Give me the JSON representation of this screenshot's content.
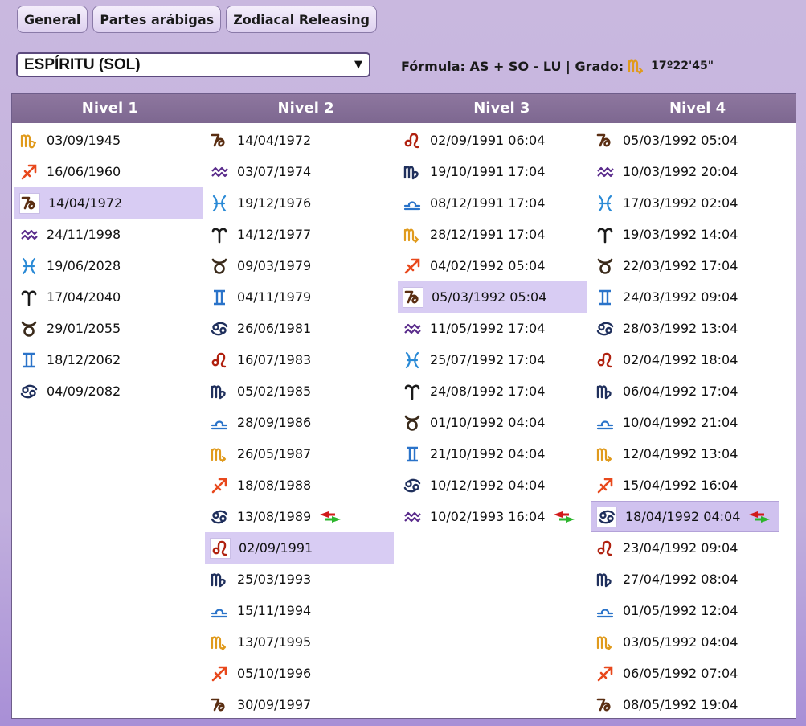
{
  "tabs": [
    "General",
    "Partes arábigas",
    "Zodiacal Releasing"
  ],
  "lot_select": "ESPÍRITU (SOL)",
  "formula": {
    "label": "Fórmula: AS + SO - LU | Grado:",
    "sign": "scorpio",
    "degree": "17º22'45\""
  },
  "columns": [
    {
      "header": "Nivel 1",
      "rows": [
        {
          "sign": "virgo",
          "date": "03/09/1945"
        },
        {
          "sign": "sagittarius",
          "date": "16/06/1960"
        },
        {
          "sign": "capricorn",
          "date": "14/04/1972",
          "selected": true
        },
        {
          "sign": "aquarius",
          "date": "24/11/1998"
        },
        {
          "sign": "pisces",
          "date": "19/06/2028"
        },
        {
          "sign": "aries",
          "date": "17/04/2040"
        },
        {
          "sign": "taurus",
          "date": "29/01/2055"
        },
        {
          "sign": "gemini",
          "date": "18/12/2062"
        },
        {
          "sign": "cancer",
          "date": "04/09/2082"
        }
      ]
    },
    {
      "header": "Nivel 2",
      "rows": [
        {
          "sign": "capricorn",
          "date": "14/04/1972"
        },
        {
          "sign": "aquarius",
          "date": "03/07/1974"
        },
        {
          "sign": "pisces",
          "date": "19/12/1976"
        },
        {
          "sign": "aries",
          "date": "14/12/1977"
        },
        {
          "sign": "taurus",
          "date": "09/03/1979"
        },
        {
          "sign": "gemini",
          "date": "04/11/1979"
        },
        {
          "sign": "cancer",
          "date": "26/06/1981"
        },
        {
          "sign": "leo",
          "date": "16/07/1983"
        },
        {
          "sign": "virgo2",
          "date": "05/02/1985"
        },
        {
          "sign": "libra",
          "date": "28/09/1986"
        },
        {
          "sign": "scorpio",
          "date": "26/05/1987"
        },
        {
          "sign": "sagittarius",
          "date": "18/08/1988"
        },
        {
          "sign": "cancer",
          "date": "13/08/1989",
          "swap": true
        },
        {
          "sign": "leo",
          "date": "02/09/1991",
          "selected": true
        },
        {
          "sign": "virgo2",
          "date": "25/03/1993"
        },
        {
          "sign": "libra",
          "date": "15/11/1994"
        },
        {
          "sign": "scorpio",
          "date": "13/07/1995"
        },
        {
          "sign": "sagittarius",
          "date": "05/10/1996"
        },
        {
          "sign": "capricorn",
          "date": "30/09/1997"
        }
      ]
    },
    {
      "header": "Nivel 3",
      "rows": [
        {
          "sign": "leo",
          "date": "02/09/1991 06:04"
        },
        {
          "sign": "virgo2",
          "date": "19/10/1991 17:04"
        },
        {
          "sign": "libra",
          "date": "08/12/1991 17:04"
        },
        {
          "sign": "scorpio",
          "date": "28/12/1991 17:04"
        },
        {
          "sign": "sagittarius",
          "date": "04/02/1992 05:04"
        },
        {
          "sign": "capricorn",
          "date": "05/03/1992 05:04",
          "selected": true
        },
        {
          "sign": "aquarius",
          "date": "11/05/1992 17:04"
        },
        {
          "sign": "pisces",
          "date": "25/07/1992 17:04"
        },
        {
          "sign": "aries",
          "date": "24/08/1992 17:04"
        },
        {
          "sign": "taurus",
          "date": "01/10/1992 04:04"
        },
        {
          "sign": "gemini",
          "date": "21/10/1992 04:04"
        },
        {
          "sign": "cancer",
          "date": "10/12/1992 04:04"
        },
        {
          "sign": "aquarius",
          "date": "10/02/1993 16:04",
          "swap": true
        }
      ]
    },
    {
      "header": "Nivel 4",
      "rows": [
        {
          "sign": "capricorn",
          "date": "05/03/1992 05:04"
        },
        {
          "sign": "aquarius",
          "date": "10/03/1992 20:04"
        },
        {
          "sign": "pisces",
          "date": "17/03/1992 02:04"
        },
        {
          "sign": "aries",
          "date": "19/03/1992 14:04"
        },
        {
          "sign": "taurus",
          "date": "22/03/1992 17:04"
        },
        {
          "sign": "gemini",
          "date": "24/03/1992 09:04"
        },
        {
          "sign": "cancer",
          "date": "28/03/1992 13:04"
        },
        {
          "sign": "leo",
          "date": "02/04/1992 18:04"
        },
        {
          "sign": "virgo2",
          "date": "06/04/1992 17:04"
        },
        {
          "sign": "libra",
          "date": "10/04/1992 21:04"
        },
        {
          "sign": "scorpio",
          "date": "12/04/1992 13:04"
        },
        {
          "sign": "sagittarius",
          "date": "15/04/1992 16:04"
        },
        {
          "sign": "cancer",
          "date": "18/04/1992 04:04",
          "selected": true,
          "strong": true,
          "swap": true
        },
        {
          "sign": "leo",
          "date": "23/04/1992 09:04"
        },
        {
          "sign": "virgo2",
          "date": "27/04/1992 08:04"
        },
        {
          "sign": "libra",
          "date": "01/05/1992 12:04"
        },
        {
          "sign": "scorpio",
          "date": "03/05/1992 04:04"
        },
        {
          "sign": "sagittarius",
          "date": "06/05/1992 07:04"
        },
        {
          "sign": "capricorn",
          "date": "08/05/1992 19:04"
        }
      ]
    }
  ]
}
